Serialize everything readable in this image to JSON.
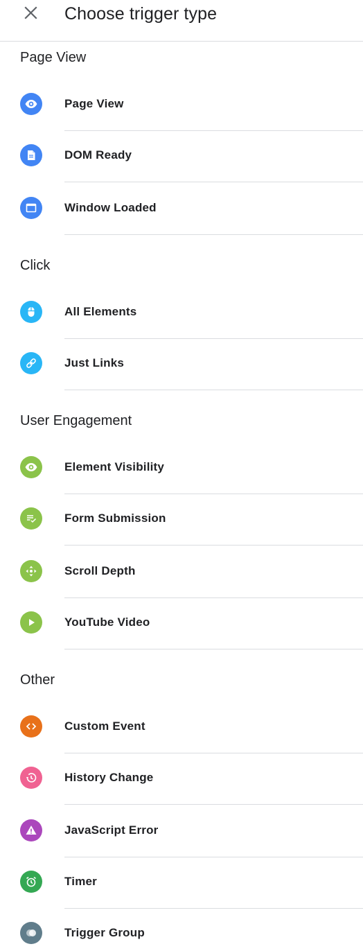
{
  "header": {
    "title": "Choose trigger type",
    "close_icon": "close-icon"
  },
  "colors": {
    "page_view": "#4285f4",
    "click": "#29b6f6",
    "engagement": "#8bc34a",
    "custom_event": "#e8711a",
    "history_change": "#f06292",
    "javascript_error": "#ab47bc",
    "timer": "#34a853",
    "trigger_group": "#607d8b"
  },
  "sections": {
    "page_view": {
      "title": "Page View",
      "items": [
        {
          "label": "Page View",
          "icon": "eye-icon"
        },
        {
          "label": "DOM Ready",
          "icon": "document-icon"
        },
        {
          "label": "Window Loaded",
          "icon": "window-icon"
        }
      ]
    },
    "click": {
      "title": "Click",
      "items": [
        {
          "label": "All Elements",
          "icon": "mouse-icon"
        },
        {
          "label": "Just Links",
          "icon": "link-icon"
        }
      ]
    },
    "user_engagement": {
      "title": "User Engagement",
      "items": [
        {
          "label": "Element Visibility",
          "icon": "eye-icon"
        },
        {
          "label": "Form Submission",
          "icon": "form-check-icon"
        },
        {
          "label": "Scroll Depth",
          "icon": "move-arrows-icon"
        },
        {
          "label": "YouTube Video",
          "icon": "play-icon"
        }
      ]
    },
    "other": {
      "title": "Other",
      "items": [
        {
          "label": "Custom Event",
          "icon": "code-brackets-icon"
        },
        {
          "label": "History Change",
          "icon": "history-icon"
        },
        {
          "label": "JavaScript Error",
          "icon": "warning-icon"
        },
        {
          "label": "Timer",
          "icon": "alarm-icon"
        },
        {
          "label": "Trigger Group",
          "icon": "group-circles-icon"
        }
      ]
    }
  }
}
